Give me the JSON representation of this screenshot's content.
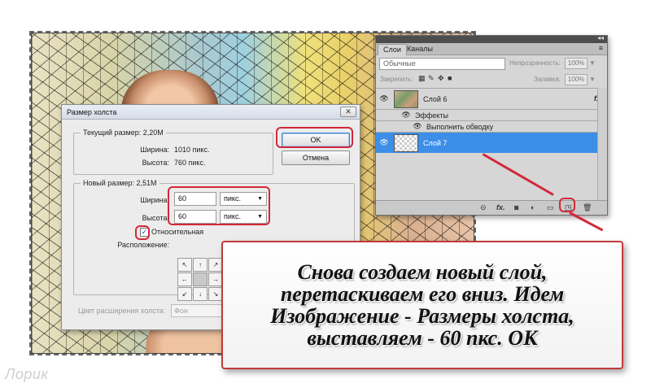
{
  "dialog": {
    "title": "Размер холста",
    "current": {
      "legend": "Текущий размер: 2,20M",
      "width_label": "Ширина:",
      "width_value": "1010 пикс.",
      "height_label": "Высота:",
      "height_value": "760 пикс."
    },
    "new_size": {
      "legend": "Новый размер: 2,51M",
      "width_label": "Ширина:",
      "width_value": "60",
      "width_unit": "пикс.",
      "height_label": "Высота:",
      "height_value": "60",
      "height_unit": "пикс.",
      "relative_label": "Относительная",
      "relative_checked": "✓",
      "anchor_label": "Расположение:",
      "anchor_arrows": [
        "↖",
        "↑",
        "↗",
        "←",
        "",
        "→",
        "↙",
        "↓",
        "↘"
      ]
    },
    "extension_label": "Цвет расширения холста:",
    "extension_value": "Фон",
    "ok_label": "OK",
    "cancel_label": "Отмена",
    "close_glyph": "✕"
  },
  "layers_panel": {
    "collapse_glyph": "◂◂",
    "tabs": [
      "Слои",
      "Каналы"
    ],
    "menu_glyph": "≡",
    "blend_mode": "Обычные",
    "opacity_label": "Непрозрачность:",
    "opacity_value": "100%",
    "lock_label": "Закрепить:",
    "fill_label": "Заливка:",
    "fill_value": "100%",
    "layers": [
      {
        "name": "Слой 6",
        "fx": "fx"
      },
      {
        "name": "Эффекты"
      },
      {
        "name": "Выполнить обводку"
      },
      {
        "name": "Слой 7"
      }
    ],
    "eye_glyph": "👁"
  },
  "caption": "Снова создаем новый слой, перетаскиваем его вниз. Идем Изображение - Размеры холста, выставляем - 60 пкс. ОК",
  "watermark": "Лорик",
  "colors": {
    "annotation": "#d3283a",
    "selection": "#3d8ee6"
  }
}
